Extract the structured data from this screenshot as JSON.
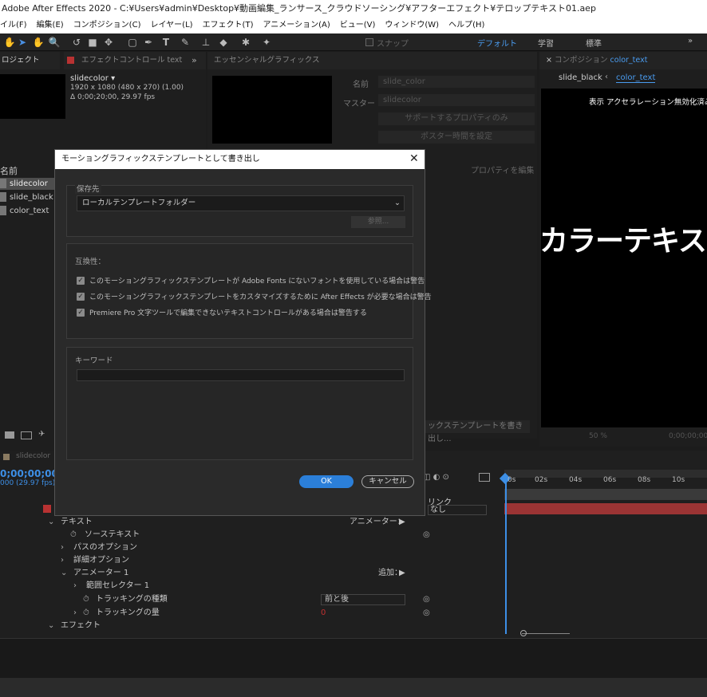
{
  "window_title": "Adobe After Effects 2020 - C:¥Users¥admin¥Desktop¥動画編集_ランサース_クラウドソーシング¥アフターエフェクト¥テロップテキスト01.aep",
  "menu": [
    "イル(F)",
    "編集(E)",
    "コンポジション(C)",
    "レイヤー(L)",
    "エフェクト(T)",
    "アニメーション(A)",
    "ビュー(V)",
    "ウィンドウ(W)",
    "ヘルプ(H)"
  ],
  "toolbar": {
    "snap_label": "スナップ",
    "workspaces": [
      "デフォルト",
      "学習",
      "標準"
    ]
  },
  "project": {
    "tab": "ロジェクト",
    "effects_tab": "エフェクトコントロール text",
    "item_name": "slidecolor ▾",
    "item_info1": "1920 x 1080  (480 x 270) (1.00)",
    "item_info2": "Δ 0;00;20;00, 29.97 fps",
    "col_name": "名前",
    "items": [
      "slidecolor",
      "slide_black",
      "color_text"
    ]
  },
  "essential": {
    "tab": "エッセンシャルグラフィックス",
    "name_label": "名前",
    "name_value": "slide_color",
    "master_label": "マスター",
    "master_value": "slidecolor",
    "btn_supported": "サポートするプロパティのみ",
    "btn_poster": "ポスター時間を設定",
    "edit_props": "プロパティを編集",
    "export_btn": "ックステンプレートを書き出し..."
  },
  "composition": {
    "tab_prefix": "コンポジション",
    "tab_name": "color_text",
    "crumb1": "slide_black",
    "crumb2": "color_text",
    "accel_note": "表示 アクセラレーション無効化済み",
    "preview_text": "カラーテキス",
    "zoom": "50 %",
    "time": "0;00;00;00"
  },
  "dialog": {
    "title": "モーショングラフィックステンプレートとして書き出し",
    "save_label": "保存先",
    "save_value": "ローカルテンプレートフォルダー",
    "browse": "参照...",
    "compat_label": "互換性：",
    "checks": [
      "このモーショングラフィックステンプレートが Adobe Fonts にないフォントを使用している場合は警告",
      "このモーショングラフィックステンプレートをカスタマイズするために After Effects が必要な場合は警告",
      "Premiere Pro 文字ツールで編集できないテキストコントロールがある場合は警告する"
    ],
    "keyword_label": "キーワード",
    "ok": "OK",
    "cancel": "キャンセル"
  },
  "timeline": {
    "tab": "slidecolor",
    "timecode": "0;00;00;00",
    "fps": "000 (29.97 fps)",
    "parent_label": "リンク",
    "parent_value": "なし",
    "rows": [
      {
        "label": "テキスト",
        "extra": "アニメーター：",
        "indent": 0
      },
      {
        "label": "ソーステキスト",
        "extra": "",
        "indent": 1
      },
      {
        "label": "パスのオプション",
        "extra": "",
        "indent": 1
      },
      {
        "label": "詳細オプション",
        "extra": "",
        "indent": 1
      },
      {
        "label": "アニメーター 1",
        "extra": "追加：",
        "indent": 1
      },
      {
        "label": "範囲セレクター 1",
        "extra": "",
        "indent": 2
      },
      {
        "label": "トラッキングの種類",
        "extra": "",
        "indent": 2
      },
      {
        "label": "トラッキングの量",
        "extra": "",
        "indent": 2
      },
      {
        "label": "エフェクト",
        "extra": "",
        "indent": 0
      }
    ],
    "tracking_type": "前と後",
    "tracking_amount": "0",
    "ruler": [
      "0s",
      "02s",
      "04s",
      "06s",
      "08s",
      "10s"
    ]
  },
  "colors": {
    "accent": "#2b7fd9",
    "layer_red": "#9b3434",
    "bg": "#1c1c1c"
  }
}
